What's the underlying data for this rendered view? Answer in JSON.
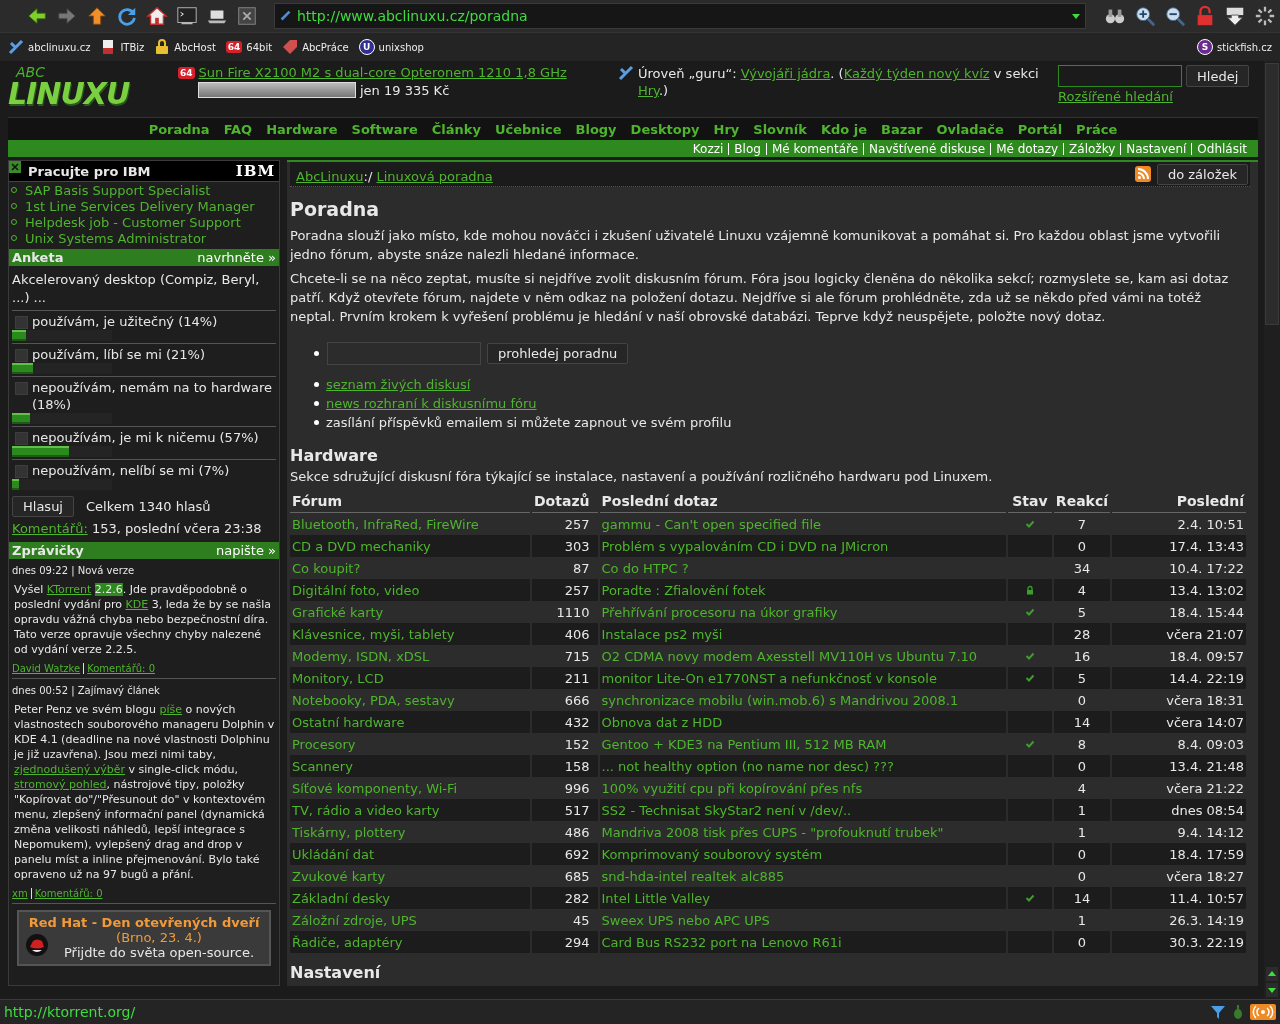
{
  "browser": {
    "url": "http://www.abclinuxu.cz/poradna"
  },
  "bookmarks": [
    {
      "label": "abclinuxu.cz"
    },
    {
      "label": "ITBiz"
    },
    {
      "label": "AbcHost"
    },
    {
      "label": "64bit",
      "badge": "64"
    },
    {
      "label": "AbcPráce"
    },
    {
      "label": "unixshop",
      "badge": "U"
    }
  ],
  "bookmark_right": {
    "label": "stickfish.cz",
    "badge": "S"
  },
  "logo": {
    "top": "ABC",
    "main": "LINUXU"
  },
  "ad": {
    "badge": "64",
    "link": "Sun Fire X2100 M2 s dual-core Opteronem 1210 1,8 GHz",
    "price": "jen 19 335 Kč"
  },
  "level": [
    {
      "kind": "text",
      "text": "Úroveň „guru“: "
    },
    {
      "kind": "link",
      "text": "Vývojáři jádra"
    },
    {
      "kind": "text",
      "text": ". ("
    },
    {
      "kind": "link",
      "text": "Každý týden nový kvíz"
    },
    {
      "kind": "text",
      "text": " v sekci "
    },
    {
      "kind": "link",
      "text": "Hry"
    },
    {
      "kind": "text",
      "text": ".)"
    }
  ],
  "search": {
    "button": "Hledej",
    "link": "Rozšířené hledání"
  },
  "nav": [
    "Poradna",
    "FAQ",
    "Hardware",
    "Software",
    "Články",
    "Učebnice",
    "Blogy",
    "Desktopy",
    "Hry",
    "Slovník",
    "Kdo je",
    "Bazar",
    "Ovladače",
    "Portál",
    "Práce"
  ],
  "user_links": [
    "Kozzi",
    "Blog",
    "Mé komentáře",
    "Navštívené diskuse",
    "Mé dotazy",
    "Záložky",
    "Nastavení",
    "Odhlásit"
  ],
  "jobs": {
    "title": "Pracujte pro IBM",
    "logo": "IBM",
    "items": [
      "SAP Basis Support Specialist",
      "1st Line Services Delivery Manager",
      "Helpdesk job - Customer Support",
      "Unix Systems Administrator"
    ]
  },
  "poll": {
    "title": "Anketa",
    "action": "navrhněte »",
    "question": "Akcelerovaný desktop (Compiz, Beryl, ...) ...",
    "options": [
      {
        "label": "používám, je užitečný (14%)",
        "checked": false,
        "level": 0.14
      },
      {
        "label": "používám, líbí se mi (21%)",
        "checked": false,
        "level": 0.21
      },
      {
        "label": "nepoužívám, nemám na to hardware (18%)",
        "checked": false,
        "level": 0.18
      },
      {
        "label": "nepoužívám, je mi k ničemu (57%)",
        "checked": false,
        "level": 0.57
      },
      {
        "label": "nepoužívám, nelíbí se mi (7%)",
        "checked": false,
        "level": 0.07
      }
    ],
    "vote_button": "Hlasuj",
    "total": "Celkem 1340 hlasů",
    "comments": [
      {
        "kind": "link",
        "text": "Komentářů:"
      },
      {
        "kind": "text",
        "text": " 153, poslední včera 23:38"
      }
    ]
  },
  "news": {
    "title": "Zprávičky",
    "action": "napište »",
    "items": [
      {
        "meta": "dnes 09:22 | Nová verze",
        "parts": [
          {
            "kind": "text",
            "text": "Vyšel "
          },
          {
            "kind": "link",
            "text": "KTorrent"
          },
          {
            "kind": "mark",
            "text": "2.2.6"
          },
          {
            "kind": "text",
            "text": ". Jde pravděpodobně o poslední vydání pro "
          },
          {
            "kind": "link",
            "text": "KDE"
          },
          {
            "kind": "text",
            "text": " 3, leda že by se našla opravdu vážná chyba nebo bezpečnostní díra. Tato verze opravuje všechny chyby nalezené od vydání verze 2.2.5."
          }
        ],
        "links": [
          "David Watzke",
          "Komentářů: 0"
        ]
      },
      {
        "meta": "dnes 00:52 | Zajímavý článek",
        "parts": [
          {
            "kind": "text",
            "text": "Peter Penz ve svém blogu "
          },
          {
            "kind": "link",
            "text": "píše"
          },
          {
            "kind": "text",
            "text": " o nových vlastnostech souborového manageru Dolphin v KDE 4.1 (deadline na nové vlastnosti Dolphinu je již uzavřena). Jsou mezi nimi taby, "
          },
          {
            "kind": "link",
            "text": "zjednodušený výběr"
          },
          {
            "kind": "text",
            "text": " v single-click módu, "
          },
          {
            "kind": "link",
            "text": "stromový pohled"
          },
          {
            "kind": "text",
            "text": ", nástrojové tipy, položky \"Kopírovat do\"/\"Přesunout do\" v kontextovém menu, zlepšený informační panel (dynamická změna velikosti náhledů, lepší integrace s Nepomukem), vylepšený drag and drop v panelu míst a inline přejmenování. Bylo také opraveno už na 97 bugů a přání."
          }
        ],
        "links": [
          "xm",
          "Komentářů: 0"
        ]
      }
    ]
  },
  "promo": {
    "title": "Red Hat - Den otevřených dveří",
    "subtitle": "(Brno, 23. 4.)",
    "text": "Přijdte do světa open-source."
  },
  "breadcrumb": [
    {
      "kind": "link",
      "text": "AbcLinuxu"
    },
    {
      "kind": "text",
      "text": ":/ "
    },
    {
      "kind": "link",
      "text": "Linuxová poradna"
    }
  ],
  "bookmark_button": "do záložek",
  "title": "Poradna",
  "paragraphs": [
    "Poradna slouží jako místo, kde mohou nováčci i zkušení uživatelé Linuxu vzájemně komunikovat a pomáhat si. Pro každou oblast jsme vytvořili jedno fórum, abyste snáze nalezli hledané informace.",
    "Chcete-li se na něco zeptat, musíte si nejdříve zvolit diskusním fórum. Fóra jsou logicky členěna do několika sekcí; rozmyslete se, kam asi dotaz patří. Když otevřete fórum, najdete v něm odkaz na položení dotazu. Nejdříve si ale fórum prohlédněte, zda už se někdo před vámi na totéž neptal. Prvním krokem k vyřešení problému je hledání v naší obrovské databázi. Teprve když neuspějete, položte nový dotaz."
  ],
  "search_button": "prohledej poradnu",
  "links": [
    {
      "kind": "link",
      "text": "seznam živých diskusí"
    },
    {
      "kind": "link",
      "text": "news rozhraní k diskusnímu fóru"
    },
    {
      "kind": "text",
      "text": "zasílání příspěvků emailem si můžete zapnout ve svém profilu"
    }
  ],
  "section": {
    "title": "Hardware",
    "description": "Sekce sdružující diskusní fóra týkající se instalace, nastavení a používání rozličného hardwaru pod Linuxem."
  },
  "table": {
    "columns": [
      "Fórum",
      "Dotazů",
      "Poslední dotaz",
      "Stav",
      "Reakcí",
      "Poslední"
    ],
    "rows": [
      {
        "forum": "Bluetooth, InfraRed, FireWire",
        "count": "257",
        "question": "gammu - Can't open specified file",
        "kind": "solved",
        "replies": "7",
        "last": "2.4. 10:51"
      },
      {
        "forum": "CD a DVD mechaniky",
        "count": "303",
        "question": "Problém s vypalováním CD i DVD na JMicron",
        "replies": "0",
        "last": "17.4. 13:43"
      },
      {
        "forum": "Co koupit?",
        "count": "87",
        "question": "Co do HTPC ?",
        "replies": "34",
        "last": "10.4. 17:22"
      },
      {
        "forum": "Digitální foto, video",
        "count": "257",
        "question": "Poradte : Zfialovění fotek",
        "kind": "locked",
        "replies": "4",
        "last": "13.4. 13:02"
      },
      {
        "forum": "Grafické karty",
        "count": "1110",
        "question": "Přehřívání procesoru na úkor grafiky",
        "kind": "solved",
        "replies": "5",
        "last": "18.4. 15:44"
      },
      {
        "forum": "Klávesnice, myši, tablety",
        "count": "406",
        "question": "Instalace ps2 myši",
        "replies": "28",
        "last": "včera 21:07"
      },
      {
        "forum": "Modemy, ISDN, xDSL",
        "count": "715",
        "question": "O2 CDMA novy modem Axesstell MV110H vs Ubuntu 7.10",
        "kind": "solved",
        "replies": "16",
        "last": "18.4. 09:57"
      },
      {
        "forum": "Monitory, LCD",
        "count": "211",
        "question": "monitor Lite-On e1770NST a nefunkčnosť v konsole",
        "kind": "solved",
        "replies": "5",
        "last": "14.4. 22:19"
      },
      {
        "forum": "Notebooky, PDA, sestavy",
        "count": "666",
        "question": "synchronizace mobilu (win.mob.6) s Mandrivou 2008.1",
        "replies": "0",
        "last": "včera 18:31"
      },
      {
        "forum": "Ostatní hardware",
        "count": "432",
        "question": "Obnova dat z HDD",
        "replies": "14",
        "last": "včera 14:07"
      },
      {
        "forum": "Procesory",
        "count": "152",
        "question": "Gentoo + KDE3 na Pentium III, 512 MB RAM",
        "kind": "solved",
        "replies": "8",
        "last": "8.4. 09:03"
      },
      {
        "forum": "Scannery",
        "count": "158",
        "question": "... not healthy option (no name nor desc) ???",
        "replies": "0",
        "last": "13.4. 21:48"
      },
      {
        "forum": "Síťové komponenty, Wi-Fi",
        "count": "996",
        "question": "100% využití cpu při kopírování přes nfs",
        "replies": "4",
        "last": "včera 21:22"
      },
      {
        "forum": "TV, rádio a video karty",
        "count": "517",
        "question": "SS2 - Technisat SkyStar2 není v /dev/..",
        "replies": "1",
        "last": "dnes 08:54"
      },
      {
        "forum": "Tiskárny, plottery",
        "count": "486",
        "question": "Mandriva 2008 tisk přes CUPS - \"profouknutí trubek\"",
        "replies": "1",
        "last": "9.4. 14:12"
      },
      {
        "forum": "Ukládání dat",
        "count": "692",
        "question": "Komprimovaný souborový systém",
        "replies": "0",
        "last": "18.4. 17:59"
      },
      {
        "forum": "Zvukové karty",
        "count": "685",
        "question": "snd-hda-intel realtek alc885",
        "replies": "0",
        "last": "včera 18:27"
      },
      {
        "forum": "Základní desky",
        "count": "282",
        "question": "Intel Little Valley",
        "kind": "solved",
        "replies": "14",
        "last": "11.4. 10:57"
      },
      {
        "forum": "Záložní zdroje, UPS",
        "count": "45",
        "question": "Sweex UPS nebo APC UPS",
        "replies": "1",
        "last": "26.3. 14:19"
      },
      {
        "forum": "Řadiče, adaptéry",
        "count": "294",
        "question": "Card Bus RS232 port na Lenovo R61i",
        "replies": "0",
        "last": "30.3. 22:19"
      }
    ]
  },
  "next_section": "Nastavení",
  "status_bar": {
    "url": "http://ktorrent.org/"
  }
}
